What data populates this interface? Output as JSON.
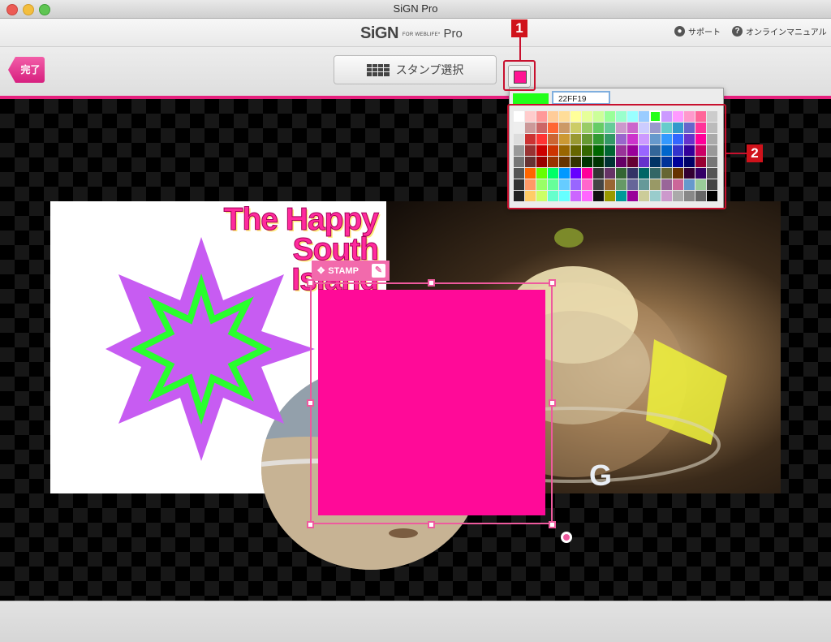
{
  "window": {
    "title": "SiGN Pro"
  },
  "brand": {
    "name": "SiGN",
    "tagline": "FOR WEBLIFE*",
    "suffix": "Pro"
  },
  "header_links": {
    "support": "サポート",
    "manual": "オンラインマニュアル"
  },
  "toolbar": {
    "done_label": "完了",
    "stamp_select_label": "スタンプ選択",
    "current_color": "#ff1493"
  },
  "callouts": {
    "one": "1",
    "two": "2"
  },
  "artwork": {
    "headline": [
      "The Happy",
      "South",
      "Island"
    ],
    "stamp_label": "STAMP",
    "stamp_color": "#ff0a98"
  },
  "palette": {
    "current_color": "#22ff19",
    "hex_value": "22FF19",
    "selected_index": 12,
    "swatches": [
      "#ffffff",
      "#ffcccc",
      "#ff9999",
      "#ffcc99",
      "#ffdd99",
      "#ffff99",
      "#e6ff99",
      "#ccff99",
      "#99ff99",
      "#99ffcc",
      "#99ffff",
      "#99ccff",
      "#9999ff",
      "#cc99ff",
      "#ff99ff",
      "#ff99cc",
      "#ff6699",
      "#cccccc",
      "#eeeeee",
      "#cc9999",
      "#cc6666",
      "#ff6633",
      "#cc9966",
      "#cccc66",
      "#99cc66",
      "#66cc66",
      "#66cc99",
      "#cc99cc",
      "#cc66cc",
      "#ccccff",
      "#9999cc",
      "#66cccc",
      "#3399cc",
      "#6666cc",
      "#ff3399",
      "#bbbbbb",
      "#dddddd",
      "#cc3333",
      "#ff3333",
      "#cc6633",
      "#cc9933",
      "#999933",
      "#669933",
      "#339933",
      "#339966",
      "#9966cc",
      "#cc33cc",
      "#cc99ff",
      "#6699cc",
      "#3399ff",
      "#3366ff",
      "#6633cc",
      "#ff0099",
      "#aaaaaa",
      "#999999",
      "#993333",
      "#cc0000",
      "#cc3300",
      "#996600",
      "#666600",
      "#336600",
      "#006600",
      "#006633",
      "#993399",
      "#990099",
      "#9966ff",
      "#336699",
      "#0066cc",
      "#3333cc",
      "#330099",
      "#cc0066",
      "#999999",
      "#777777",
      "#663333",
      "#990000",
      "#993300",
      "#663300",
      "#333300",
      "#003300",
      "#003300",
      "#003333",
      "#660066",
      "#660033",
      "#6633cc",
      "#003366",
      "#003399",
      "#000099",
      "#000066",
      "#990033",
      "#777777",
      "#555555",
      "#ff6600",
      "#66ff00",
      "#00ff66",
      "#0099ff",
      "#6600ff",
      "#ff0099",
      "#333333",
      "#663366",
      "#336633",
      "#333366",
      "#006666",
      "#336666",
      "#666633",
      "#663300",
      "#330033",
      "#330066",
      "#555555",
      "#333333",
      "#ff9966",
      "#99ff66",
      "#66ff99",
      "#66ccff",
      "#9966ff",
      "#ff66cc",
      "#444444",
      "#996633",
      "#669966",
      "#666699",
      "#669999",
      "#999966",
      "#996699",
      "#cc6699",
      "#6699cc",
      "#99cc99",
      "#444444",
      "#222222",
      "#ffcc66",
      "#ccff66",
      "#66ffcc",
      "#66ffff",
      "#cc66ff",
      "#ff66ff",
      "#111111",
      "#999900",
      "#009999",
      "#990099",
      "#cccc99",
      "#99cccc",
      "#cc99cc",
      "#aaaaaa",
      "#888888",
      "#666666",
      "#000000"
    ]
  }
}
